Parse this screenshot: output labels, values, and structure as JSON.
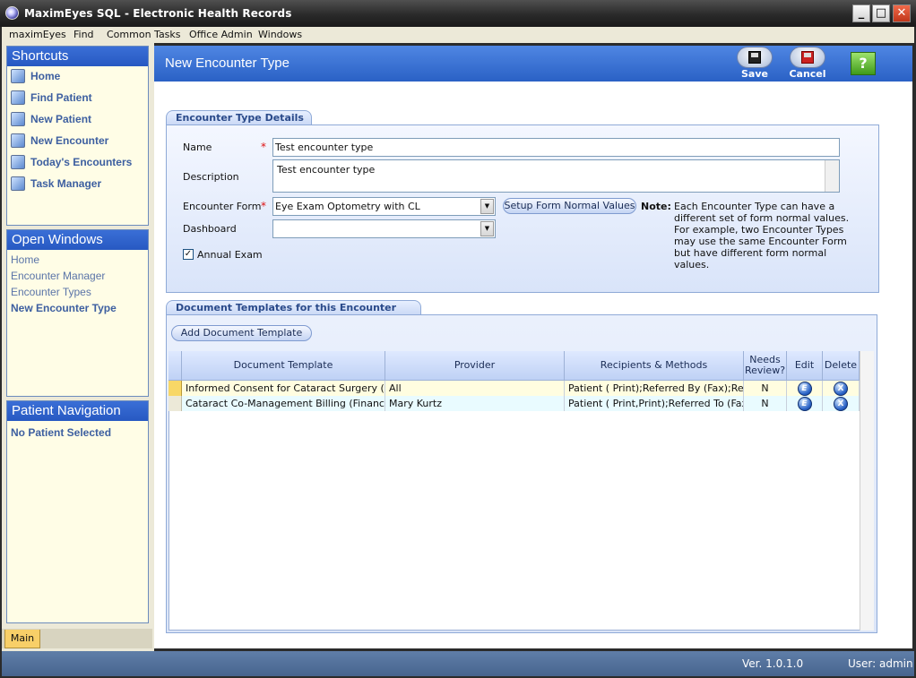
{
  "window": {
    "title": "MaximEyes SQL - Electronic Health Records",
    "minimize": "_",
    "maximize": "□",
    "close": "✕"
  },
  "menu": [
    "maximEyes",
    "Find",
    "Common Tasks",
    "Office Admin",
    "Windows"
  ],
  "shortcuts": {
    "title": "Shortcuts",
    "items": [
      {
        "label": "Home",
        "icon": "home-icon"
      },
      {
        "label": "Find Patient",
        "icon": "find-patient-icon"
      },
      {
        "label": "New Patient",
        "icon": "new-patient-icon"
      },
      {
        "label": "New Encounter",
        "icon": "new-encounter-icon"
      },
      {
        "label": "Today's Encounters",
        "icon": "clock-icon"
      },
      {
        "label": "Task Manager",
        "icon": "task-icon"
      }
    ]
  },
  "open_windows": {
    "title": "Open Windows",
    "items": [
      "Home",
      "Encounter Manager",
      "Encounter Types",
      "New Encounter Type"
    ],
    "active_index": 3
  },
  "patient_nav": {
    "title": "Patient Navigation",
    "status": "No Patient Selected"
  },
  "main_tab": "Main",
  "page": {
    "title": "New Encounter Type"
  },
  "toolbar": {
    "save": "Save",
    "cancel": "Cancel",
    "help": "?"
  },
  "details": {
    "section_title": "Encounter Type Details",
    "name_label": "Name",
    "name_value": "Test encounter type",
    "description_label": "Description",
    "description_value": "Test encounter type",
    "form_label": "Encounter Form",
    "form_value": "Eye Exam Optometry with CL",
    "dashboard_label": "Dashboard",
    "dashboard_value": "",
    "setup_button": "Setup Form Normal Values",
    "note_label": "Note:",
    "note_text": "Each Encounter Type can have a different set of form normal values.  For example, two Encounter Types may use the same Encounter Form but have different form normal values.",
    "annual_exam_label": "Annual Exam",
    "annual_exam_checked": true,
    "required_mark": "*"
  },
  "templates": {
    "section_title": "Document Templates for this Encounter Type",
    "add_button": "Add Document Template",
    "columns": [
      "Document Template",
      "Provider",
      "Recipients & Methods",
      "Needs Review?",
      "Edit",
      "Delete"
    ],
    "rows": [
      {
        "template": "Informed Consent for Cataract Surgery (Co",
        "provider": "All",
        "recipients": "Patient ( Print);Referred By (Fax);Ref",
        "review": "N"
      },
      {
        "template": "Cataract Co-Management Billing (Financial",
        "provider": "Mary Kurtz",
        "recipients": "Patient ( Print,Print);Referred To (Fax",
        "review": "N"
      }
    ],
    "edit_glyph": "E",
    "delete_glyph": "X"
  },
  "status": {
    "version": "Ver. 1.0.1.0",
    "user": "User: admin"
  }
}
